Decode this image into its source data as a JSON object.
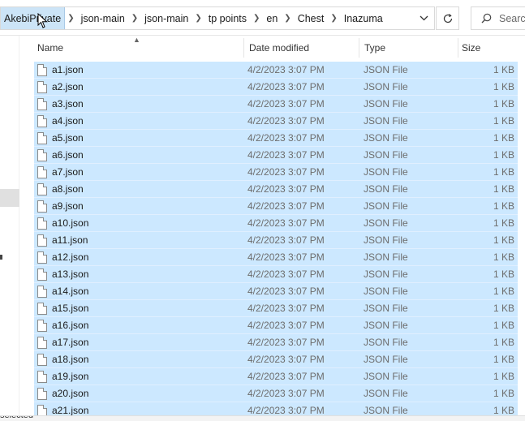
{
  "breadcrumb": {
    "items": [
      "AkebiPrivate",
      "json-main",
      "json-main",
      "tp points",
      "en",
      "Chest",
      "Inazuma"
    ]
  },
  "search": {
    "placeholder": "Search"
  },
  "columns": {
    "name": "Name",
    "date": "Date modified",
    "type": "Type",
    "size": "Size"
  },
  "files": [
    {
      "name": "a1.json",
      "date": "4/2/2023 3:07 PM",
      "type": "JSON File",
      "size": "1 KB"
    },
    {
      "name": "a2.json",
      "date": "4/2/2023 3:07 PM",
      "type": "JSON File",
      "size": "1 KB"
    },
    {
      "name": "a3.json",
      "date": "4/2/2023 3:07 PM",
      "type": "JSON File",
      "size": "1 KB"
    },
    {
      "name": "a4.json",
      "date": "4/2/2023 3:07 PM",
      "type": "JSON File",
      "size": "1 KB"
    },
    {
      "name": "a5.json",
      "date": "4/2/2023 3:07 PM",
      "type": "JSON File",
      "size": "1 KB"
    },
    {
      "name": "a6.json",
      "date": "4/2/2023 3:07 PM",
      "type": "JSON File",
      "size": "1 KB"
    },
    {
      "name": "a7.json",
      "date": "4/2/2023 3:07 PM",
      "type": "JSON File",
      "size": "1 KB"
    },
    {
      "name": "a8.json",
      "date": "4/2/2023 3:07 PM",
      "type": "JSON File",
      "size": "1 KB"
    },
    {
      "name": "a9.json",
      "date": "4/2/2023 3:07 PM",
      "type": "JSON File",
      "size": "1 KB"
    },
    {
      "name": "a10.json",
      "date": "4/2/2023 3:07 PM",
      "type": "JSON File",
      "size": "1 KB"
    },
    {
      "name": "a11.json",
      "date": "4/2/2023 3:07 PM",
      "type": "JSON File",
      "size": "1 KB"
    },
    {
      "name": "a12.json",
      "date": "4/2/2023 3:07 PM",
      "type": "JSON File",
      "size": "1 KB"
    },
    {
      "name": "a13.json",
      "date": "4/2/2023 3:07 PM",
      "type": "JSON File",
      "size": "1 KB"
    },
    {
      "name": "a14.json",
      "date": "4/2/2023 3:07 PM",
      "type": "JSON File",
      "size": "1 KB"
    },
    {
      "name": "a15.json",
      "date": "4/2/2023 3:07 PM",
      "type": "JSON File",
      "size": "1 KB"
    },
    {
      "name": "a16.json",
      "date": "4/2/2023 3:07 PM",
      "type": "JSON File",
      "size": "1 KB"
    },
    {
      "name": "a17.json",
      "date": "4/2/2023 3:07 PM",
      "type": "JSON File",
      "size": "1 KB"
    },
    {
      "name": "a18.json",
      "date": "4/2/2023 3:07 PM",
      "type": "JSON File",
      "size": "1 KB"
    },
    {
      "name": "a19.json",
      "date": "4/2/2023 3:07 PM",
      "type": "JSON File",
      "size": "1 KB"
    },
    {
      "name": "a20.json",
      "date": "4/2/2023 3:07 PM",
      "type": "JSON File",
      "size": "1 KB"
    },
    {
      "name": "a21.json",
      "date": "4/2/2023 3:07 PM",
      "type": "JSON File",
      "size": "1 KB"
    }
  ],
  "status": {
    "text": "selected"
  },
  "colors": {
    "selection": "#cce8ff",
    "breadcrumb_active": "#cce4f7"
  }
}
